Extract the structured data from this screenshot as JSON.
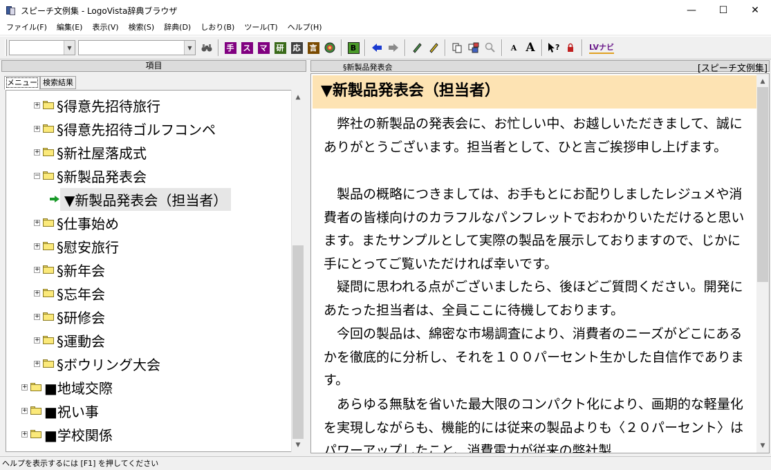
{
  "window": {
    "title": "スピーチ文例集 - LogoVista辞典ブラウザ",
    "minimize": "—",
    "maximize": "☐",
    "close": "✕"
  },
  "menu": [
    "ファイル(F)",
    "編集(E)",
    "表示(V)",
    "検索(S)",
    "辞典(D)",
    "しおり(B)",
    "ツール(T)",
    "ヘルプ(H)"
  ],
  "toolbar": {
    "dict_buttons": [
      {
        "label": "手",
        "color": "#800080"
      },
      {
        "label": "ス",
        "color": "#800080"
      },
      {
        "label": "マ",
        "color": "#800080"
      },
      {
        "label": "研",
        "color": "#3a6a1a"
      },
      {
        "label": "応",
        "color": "#404040"
      },
      {
        "label": "言",
        "color": "#7a4a00"
      }
    ],
    "b_label": "B",
    "font_small": "A",
    "font_large": "A",
    "lv_label": "LVナビ"
  },
  "left": {
    "header": "項目",
    "tabs": [
      "メニュー",
      "検索結果"
    ],
    "tree": [
      {
        "label": "§得意先招待旅行",
        "level": 2,
        "expander": "+"
      },
      {
        "label": "§得意先招待ゴルフコンペ",
        "level": 2,
        "expander": "+"
      },
      {
        "label": "§新社屋落成式",
        "level": 2,
        "expander": "+"
      },
      {
        "label": "§新製品発表会",
        "level": 2,
        "expander": "−"
      },
      {
        "label": "▼新製品発表会（担当者）",
        "level": 3,
        "expander": ""
      },
      {
        "label": "§仕事始め",
        "level": 2,
        "expander": "+"
      },
      {
        "label": "§慰安旅行",
        "level": 2,
        "expander": "+"
      },
      {
        "label": "§新年会",
        "level": 2,
        "expander": "+"
      },
      {
        "label": "§忘年会",
        "level": 2,
        "expander": "+"
      },
      {
        "label": "§研修会",
        "level": 2,
        "expander": "+"
      },
      {
        "label": "§運動会",
        "level": 2,
        "expander": "+"
      },
      {
        "label": "§ボウリング大会",
        "level": 2,
        "expander": "+"
      },
      {
        "label": "■地域交際",
        "level": 1,
        "expander": "+"
      },
      {
        "label": "■祝い事",
        "level": 1,
        "expander": "+"
      },
      {
        "label": "■学校関係",
        "level": 1,
        "expander": "+"
      }
    ]
  },
  "right": {
    "section": "§新製品発表会",
    "book": "[スピーチ文例集]",
    "title": "▼新製品発表会（担当者）",
    "paragraphs": [
      "　弊社の新製品の発表会に、お忙しい中、お越しいただきまして、誠にありがとうございます。担当者として、ひと言ご挨拶申し上げます。",
      "　製品の概略につきましては、お手もとにお配りしましたレジュメや消費者の皆様向けのカラフルなパンフレットでおわかりいただけると思います。またサンプルとして実際の製品を展示しておりますので、じかに手にとってご覧いただければ幸いです。",
      "　疑問に思われる点がございましたら、後ほどご質問ください。開発にあたった担当者は、全員ここに待機しております。",
      "　今回の製品は、綿密な市場調査により、消費者のニーズがどこにあるかを徹底的に分析し、それを１００パーセント生かした自信作であります。",
      "　あらゆる無駄を省いた最大限のコンパクト化により、画期的な軽量化を実現しながらも、機能的には従来の製品よりも〈２０パーセント〉はパワーアップしたこと、消費電力が従来の弊社製"
    ]
  },
  "status": "ヘルプを表示するには [F1] を押してください"
}
